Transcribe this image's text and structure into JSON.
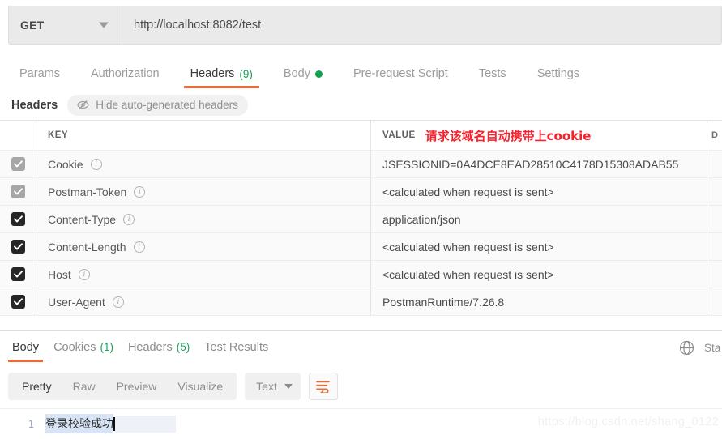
{
  "request": {
    "method": "GET",
    "method_caret_icon": "chevron-down-icon",
    "url": "http://localhost:8082/test",
    "tabs": [
      {
        "label": "Params",
        "count": "",
        "active": false,
        "dot": false
      },
      {
        "label": "Authorization",
        "count": "",
        "active": false,
        "dot": false
      },
      {
        "label": "Headers",
        "count": "(9)",
        "active": true,
        "dot": false
      },
      {
        "label": "Body",
        "count": "",
        "active": false,
        "dot": true
      },
      {
        "label": "Pre-request Script",
        "count": "",
        "active": false,
        "dot": false
      },
      {
        "label": "Tests",
        "count": "",
        "active": false,
        "dot": false
      },
      {
        "label": "Settings",
        "count": "",
        "active": false,
        "dot": false
      }
    ]
  },
  "headers_section": {
    "title": "Headers",
    "hide_auto_label": "Hide auto-generated headers",
    "hide_auto_icon": "eye-slash-icon",
    "columns": {
      "key": "KEY",
      "value": "VALUE",
      "description": "D"
    },
    "annotation": "请求该域名自动携带上cookie",
    "annotation_color": "#f5222d",
    "rows": [
      {
        "checked": true,
        "checkbox_state": "dim",
        "key": "Cookie",
        "info_icon": "info-icon",
        "value": "JSESSIONID=0A4DCE8EAD28510C4178D15308ADAB55"
      },
      {
        "checked": true,
        "checkbox_state": "dim",
        "key": "Postman-Token",
        "info_icon": "info-icon",
        "value": "<calculated when request is sent>"
      },
      {
        "checked": true,
        "checkbox_state": "on",
        "key": "Content-Type",
        "info_icon": "info-icon",
        "value": "application/json"
      },
      {
        "checked": true,
        "checkbox_state": "on",
        "key": "Content-Length",
        "info_icon": "info-icon",
        "value": "<calculated when request is sent>"
      },
      {
        "checked": true,
        "checkbox_state": "on",
        "key": "Host",
        "info_icon": "info-icon",
        "value": "<calculated when request is sent>"
      },
      {
        "checked": true,
        "checkbox_state": "on",
        "key": "User-Agent",
        "info_icon": "info-icon",
        "value": "PostmanRuntime/7.26.8"
      }
    ]
  },
  "response": {
    "tabs": [
      {
        "label": "Body",
        "count": "",
        "active": true
      },
      {
        "label": "Cookies",
        "count": "(1)",
        "active": false
      },
      {
        "label": "Headers",
        "count": "(5)",
        "active": false
      },
      {
        "label": "Test Results",
        "count": "",
        "active": false
      }
    ],
    "globe_icon": "globe-icon",
    "status_label": "Sta",
    "view_modes": [
      {
        "label": "Pretty",
        "active": true
      },
      {
        "label": "Raw",
        "active": false
      },
      {
        "label": "Preview",
        "active": false
      },
      {
        "label": "Visualize",
        "active": false
      }
    ],
    "format_select": "Text",
    "format_caret_icon": "chevron-down-icon",
    "wrap_button_icon": "word-wrap-icon",
    "wrap_button_color": "#ef6b33",
    "body": {
      "line_number": "1",
      "text": "登录校验成功"
    }
  },
  "watermark": "https://blog.csdn.net/shang_0122",
  "accent_color": "#ef6b33",
  "success_color": "#1aa35b"
}
